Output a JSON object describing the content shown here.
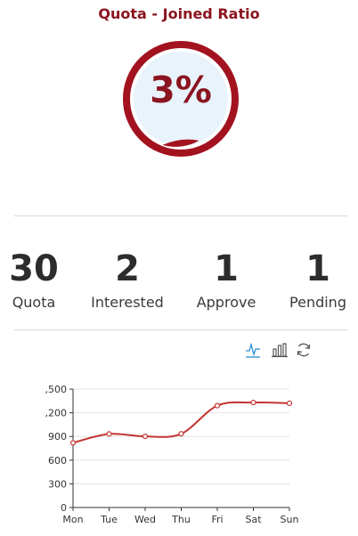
{
  "header": {
    "title": "Quota - Joined Ratio"
  },
  "gauge": {
    "value_label": "3%",
    "fraction": 0.03,
    "accent": "#a3121f",
    "fill_color": "#e2f1fb"
  },
  "stats": [
    {
      "value": "30",
      "label": "Quota"
    },
    {
      "value": "2",
      "label": "Interested"
    },
    {
      "value": "1",
      "label": "Approve"
    },
    {
      "value": "1",
      "label": "Pending"
    }
  ],
  "toolbar": {
    "icons": [
      "line-chart-icon",
      "bar-chart-icon",
      "refresh-icon"
    ]
  },
  "chart_data": {
    "type": "line",
    "categories": [
      "Mon",
      "Tue",
      "Wed",
      "Thu",
      "Fri",
      "Sat",
      "Sun"
    ],
    "series": [
      {
        "values": [
          820,
          932,
          901,
          934,
          1290,
          1330,
          1320
        ]
      }
    ],
    "ytick_labels": [
      "0",
      "300",
      "600",
      "900",
      ",200",
      ",500"
    ],
    "ylim": [
      0,
      1500
    ],
    "grid": true,
    "color": "#c23531"
  }
}
